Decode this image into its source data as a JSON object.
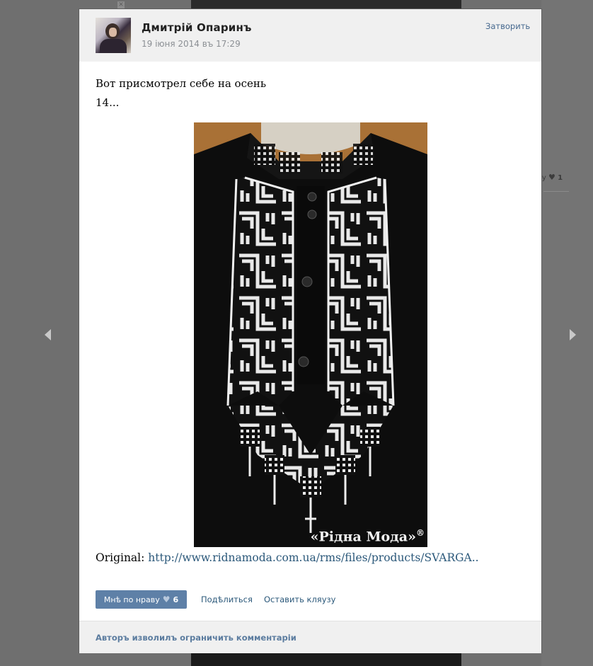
{
  "background": {
    "side_like_label": "ву",
    "side_like_count": "1",
    "close_x": "✕"
  },
  "post": {
    "author": "Дмитрій Опаринъ",
    "date": "19 іюня 2014 въ 17:29",
    "close_label": "Затворить",
    "text_line1": "Вот присмотрел себе на осень",
    "text_line2": "14...",
    "image_watermark": "«Рідна Мода»",
    "image_watermark_mark": "®",
    "original_label": "Original:",
    "original_link": "http://www.ridnamoda.com.ua/rms/files/products/SVARGA..",
    "like_label": "Мнѣ по нраву",
    "like_count": "6",
    "share_label": "Подѣлиться",
    "complain_label": "Оставить кляузу",
    "footer_note": "Авторъ изволилъ ограничить комментаріи"
  },
  "icons": {
    "heart": "heart-icon",
    "prev": "arrow-left-icon",
    "next": "arrow-right-icon"
  },
  "colors": {
    "link": "#2b587a",
    "button": "#5e80a7",
    "header_bg": "#f0f0f0"
  }
}
